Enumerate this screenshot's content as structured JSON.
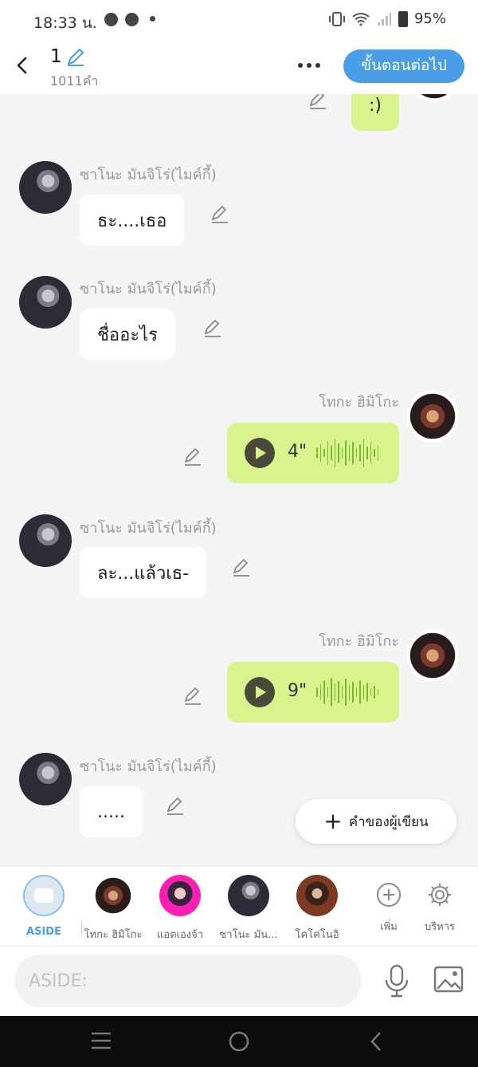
{
  "status_bar": {
    "time": "18:33 น.",
    "battery": "95%"
  },
  "header": {
    "title": "1",
    "word_count": "1011คำ",
    "next_label": "ขั้นตอนต่อไป"
  },
  "chat": {
    "top_partial": {
      "text": ":)"
    },
    "messages": [
      {
        "side": "left",
        "name": "ซาโนะ มันจิโร่(ไมค์กี้)",
        "type": "text",
        "text": "ธะ....เธอ"
      },
      {
        "side": "left",
        "name": "ซาโนะ มันจิโร่(ไมค์กี้)",
        "type": "text",
        "text": "ชื่ออะไร"
      },
      {
        "side": "right",
        "name": "โทกะ ฮิมิโกะ",
        "type": "audio",
        "duration": "4\""
      },
      {
        "side": "left",
        "name": "ซาโนะ มันจิโร่(ไมค์กี้)",
        "type": "text",
        "text": "ละ...แล้วเธ-"
      },
      {
        "side": "right",
        "name": "โทกะ ฮิมิโกะ",
        "type": "audio",
        "duration": "9\""
      },
      {
        "side": "left",
        "name": "ซาโนะ มันจิโร่(ไมค์กี้)",
        "type": "text",
        "text": "....."
      }
    ]
  },
  "author_words_label": "คำของผู้เขียน",
  "characters": [
    {
      "label": "ASIDE"
    },
    {
      "label": "โทกะ ฮิมิโกะ"
    },
    {
      "label": "แอตเองจ้า"
    },
    {
      "label": "ซาโนะ มัน..."
    },
    {
      "label": "โคโค่โนอิ"
    }
  ],
  "tools": {
    "add_label": "เพิ่ม",
    "manage_label": "บริหาร"
  },
  "input": {
    "placeholder": "ASIDE:"
  }
}
